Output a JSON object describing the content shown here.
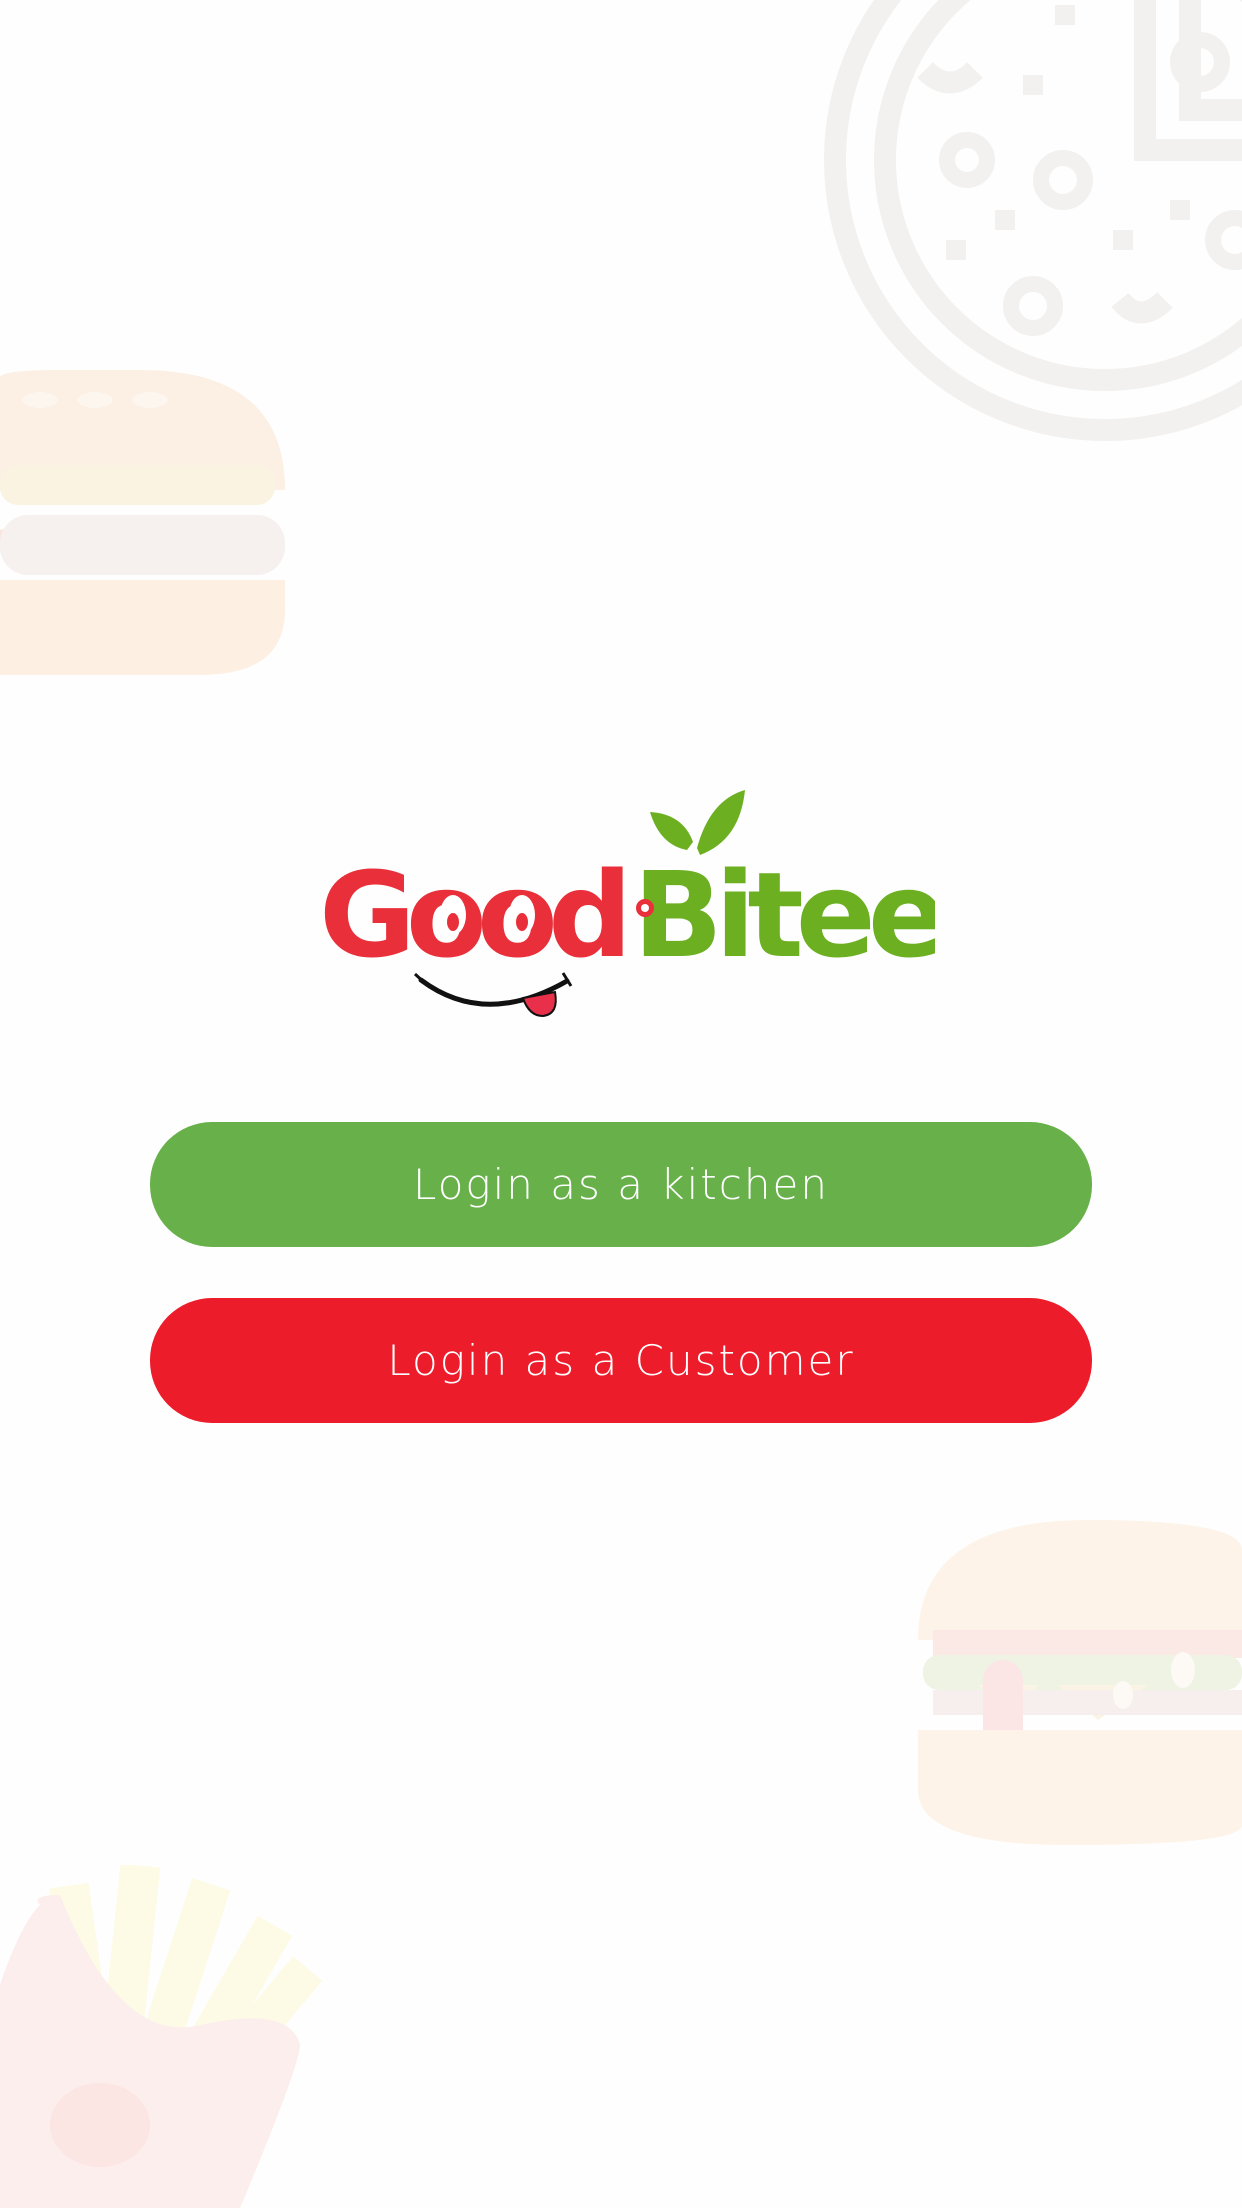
{
  "app": {
    "brand_left": "Good",
    "brand_right": "Bitee"
  },
  "buttons": {
    "kitchen_label": "Login as a kitchen",
    "customer_label": "Login as a Customer"
  },
  "colors": {
    "brand_red": "#e9303a",
    "brand_green": "#6cb022",
    "kitchen_button": "#67b04a",
    "customer_button": "#ed1c2a",
    "background": "#fefefe"
  },
  "background_icons": [
    "pizza-icon",
    "burger-icon",
    "burger-icon",
    "fries-icon"
  ]
}
